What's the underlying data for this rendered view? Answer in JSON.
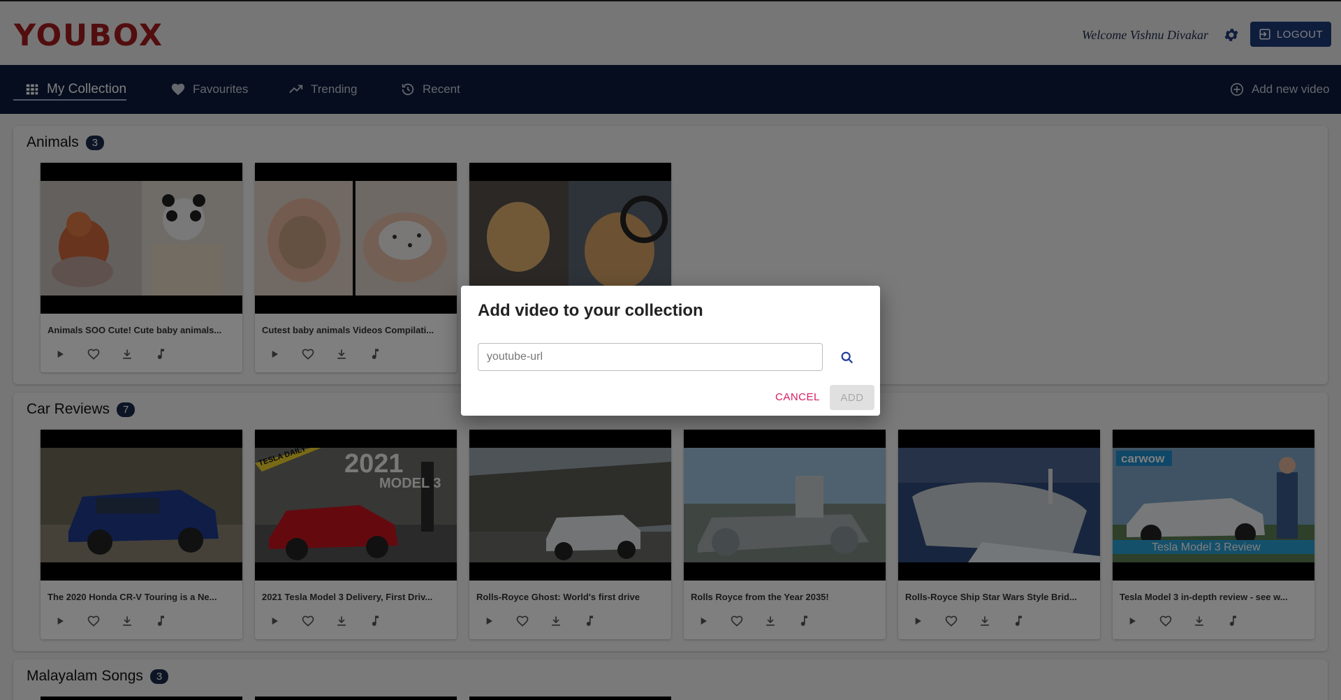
{
  "app": {
    "logo": "YOUBOX",
    "welcome": "Welcome Vishnu Divakar",
    "logout_label": "LOGOUT"
  },
  "nav": {
    "items": [
      {
        "label": "My Collection",
        "icon": "grid-icon"
      },
      {
        "label": "Favourites",
        "icon": "heart-icon"
      },
      {
        "label": "Trending",
        "icon": "trending-icon"
      },
      {
        "label": "Recent",
        "icon": "history-icon"
      }
    ],
    "add_video_label": "Add new video"
  },
  "sections": [
    {
      "title": "Animals",
      "count": "3",
      "videos": [
        {
          "title": "Animals SOO Cute! Cute baby animals..."
        },
        {
          "title": "Cutest baby animals Videos Compilati..."
        },
        {
          "title": ""
        }
      ]
    },
    {
      "title": "Car Reviews",
      "count": "7",
      "videos": [
        {
          "title": "The 2020 Honda CR-V Touring is a Ne..."
        },
        {
          "title": "2021 Tesla Model 3 Delivery, First Driv..."
        },
        {
          "title": "Rolls-Royce Ghost: World's first drive"
        },
        {
          "title": "Rolls Royce from the Year 2035!"
        },
        {
          "title": "Rolls-Royce Ship Star Wars Style Brid..."
        },
        {
          "title": "Tesla Model 3 in-depth review - see w..."
        }
      ]
    },
    {
      "title": "Malayalam Songs",
      "count": "3"
    }
  ],
  "thumbnail_text": {
    "tesla_daily": "TESLA DAILY",
    "year": "2021",
    "model": "MODEL 3",
    "carwow": "carwow",
    "tesla_review": "Tesla Model 3 Review"
  },
  "dialog": {
    "title": "Add video to your collection",
    "input_placeholder": "youtube-url",
    "input_value": "",
    "cancel_label": "CANCEL",
    "add_label": "ADD"
  },
  "colors": {
    "brand": "#a51c1f",
    "navbar": "#0c1a3c",
    "primary": "#1f3a7a",
    "cancel": "#d81b60"
  }
}
